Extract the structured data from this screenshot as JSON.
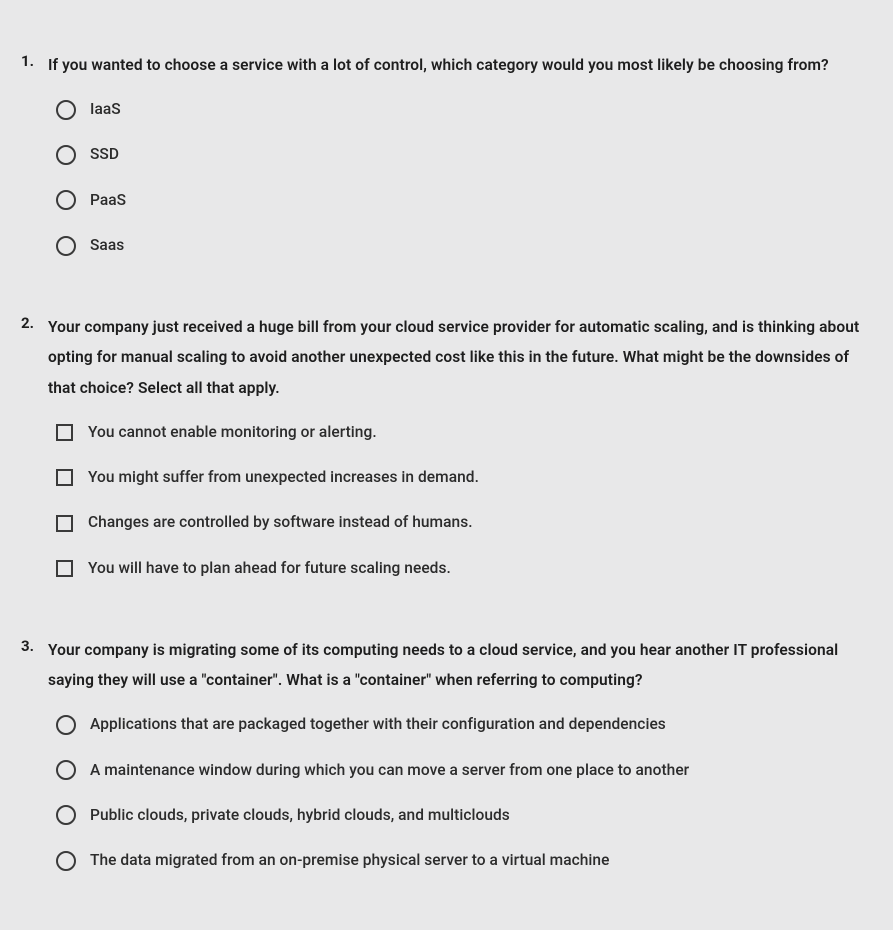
{
  "questions": [
    {
      "number": "1.",
      "text": "If you wanted to choose a service with a lot of control, which category would you most likely be choosing from?",
      "type": "radio",
      "options": [
        "IaaS",
        "SSD",
        "PaaS",
        "Saas"
      ]
    },
    {
      "number": "2.",
      "text": "Your company just received a huge bill from your cloud service provider for automatic scaling, and is thinking about opting for manual scaling to avoid another unexpected cost like this in the future. What might be the downsides of that choice? Select all that apply.",
      "type": "checkbox",
      "options": [
        "You cannot enable monitoring or alerting.",
        "You might suffer from unexpected increases in demand.",
        "Changes are controlled by software instead of humans.",
        "You will have to plan ahead for future scaling needs."
      ]
    },
    {
      "number": "3.",
      "text": "Your company is migrating some of its computing needs to a cloud service, and you hear another IT professional saying they will use a \"container\". What is a \"container\" when referring to computing?",
      "type": "radio",
      "options": [
        "Applications that are packaged together with their configuration and dependencies",
        "A maintenance window during which you can move a server from one place to another",
        "Public clouds, private clouds, hybrid clouds, and multiclouds",
        "The data migrated from an on-premise physical server to a virtual machine"
      ]
    }
  ]
}
